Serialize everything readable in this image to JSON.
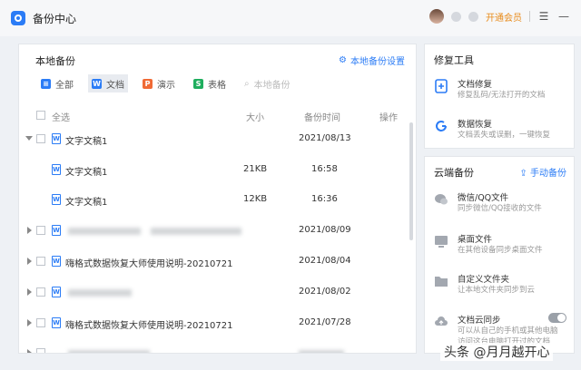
{
  "app": {
    "title": "备份中心",
    "vip_label": "开通会员"
  },
  "local_backup": {
    "title": "本地备份",
    "settings_label": "本地备份设置",
    "filters": [
      {
        "label": "全部",
        "icon": "list-icon",
        "color": "#2b7cf6",
        "active": false
      },
      {
        "label": "文档",
        "icon": "word-icon",
        "color": "#2b7cf6",
        "active": true
      },
      {
        "label": "演示",
        "icon": "ppt-icon",
        "color": "#f06a35",
        "active": false
      },
      {
        "label": "表格",
        "icon": "excel-icon",
        "color": "#1fae5e",
        "active": false
      },
      {
        "label": "本地备份",
        "icon": "search-icon",
        "color": "#bbb",
        "active": false
      }
    ],
    "columns": {
      "select_all": "全选",
      "size": "大小",
      "time": "备份时间",
      "action": "操作"
    },
    "rows": [
      {
        "name": "文字文稿1",
        "size": "",
        "time": "2021/08/13"
      },
      {
        "name": "文字文稿1",
        "size": "21KB",
        "time": "16:58"
      },
      {
        "name": "文字文稿1",
        "size": "12KB",
        "time": "16:36"
      },
      {
        "name": "",
        "size": "",
        "time": "2021/08/09"
      },
      {
        "name": "嗨格式数据恢复大师使用说明-20210721",
        "size": "",
        "time": "2021/08/04"
      },
      {
        "name": "",
        "size": "",
        "time": "2021/08/02"
      },
      {
        "name": "嗨格式数据恢复大师使用说明-20210721",
        "size": "",
        "time": "2021/07/28"
      }
    ]
  },
  "repair_tools": {
    "title": "修复工具",
    "items": [
      {
        "name": "文档修复",
        "desc": "修复乱码/无法打开的文档"
      },
      {
        "name": "数据恢复",
        "desc": "文档丢失或误删，一键恢复"
      }
    ]
  },
  "cloud_backup": {
    "title": "云端备份",
    "manual_label": "手动备份",
    "items": [
      {
        "name": "微信/QQ文件",
        "desc": "同步微信/QQ接收的文件"
      },
      {
        "name": "桌面文件",
        "desc": "在其他设备同步桌面文件"
      },
      {
        "name": "自定义文件夹",
        "desc": "让本地文件夹同步到云"
      },
      {
        "name": "文档云同步",
        "desc": "可以从自己的手机或其他电脑",
        "desc2": "访问这台电脑打开过的文档"
      }
    ]
  },
  "watermark": "头条 @月月越开心"
}
